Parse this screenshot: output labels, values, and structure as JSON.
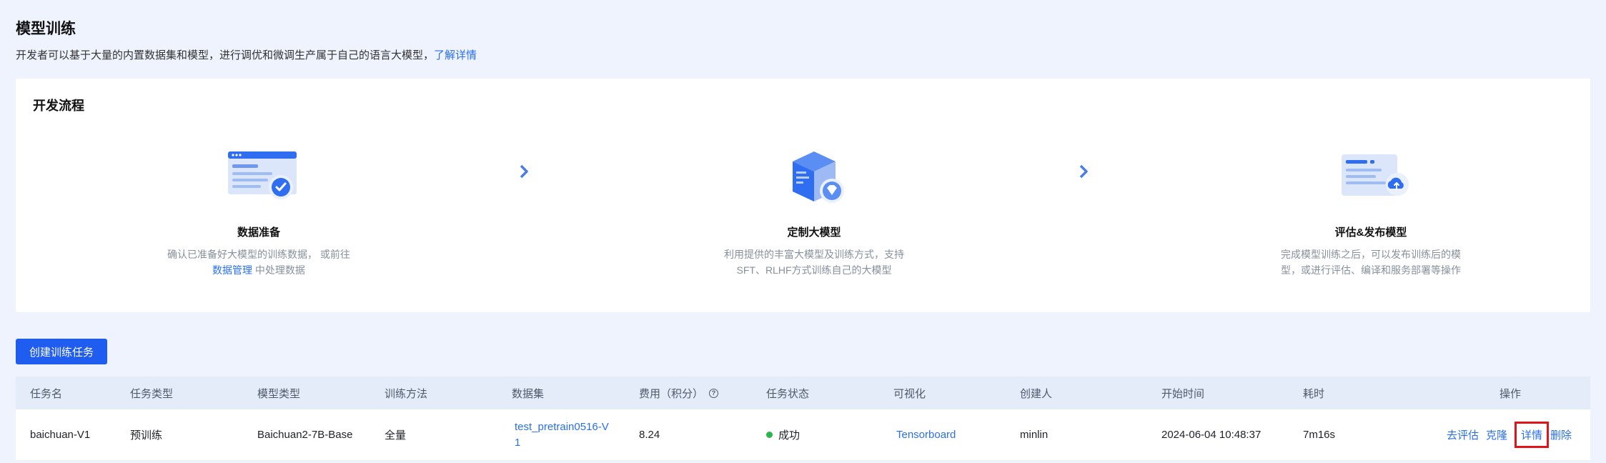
{
  "header": {
    "title": "模型训练",
    "desc": "开发者可以基于大量的内置数据集和模型，进行调优和微调生产属于自己的语言大模型，",
    "learn_more": "了解详情"
  },
  "flow": {
    "title": "开发流程",
    "steps": [
      {
        "name": "数据准备",
        "desc_before": "确认已准备好大模型的训练数据， 或前往 ",
        "desc_link": "数据管理",
        "desc_after": " 中处理数据"
      },
      {
        "name": "定制大模型",
        "desc": "利用提供的丰富大模型及训练方式，支持SFT、RLHF方式训练自己的大模型"
      },
      {
        "name": "评估&发布模型",
        "desc": "完成模型训练之后，可以发布训练后的模型，或进行评估、编译和服务部署等操作"
      }
    ]
  },
  "create_button": "创建训练任务",
  "table": {
    "columns": [
      "任务名",
      "任务类型",
      "模型类型",
      "训练方法",
      "数据集",
      "费用（积分）",
      "任务状态",
      "可视化",
      "创建人",
      "开始时间",
      "耗时",
      "操作"
    ],
    "rows": [
      {
        "name": "baichuan-V1",
        "task_type": "预训练",
        "model_type": "Baichuan2-7B-Base",
        "method": "全量",
        "dataset": "test_pretrain0516-V1",
        "cost": "8.24",
        "status": "成功",
        "visual": "Tensorboard",
        "creator": "minlin",
        "start_time": "2024-06-04 10:48:37",
        "duration": "7m16s",
        "ops": {
          "evaluate": "去评估",
          "clone": "克隆",
          "detail": "详情",
          "delete": "删除"
        }
      }
    ]
  },
  "colors": {
    "primary": "#1f5cf0",
    "link": "#2a6ff0",
    "success": "#2bb54d",
    "highlight": "#e0151a"
  }
}
